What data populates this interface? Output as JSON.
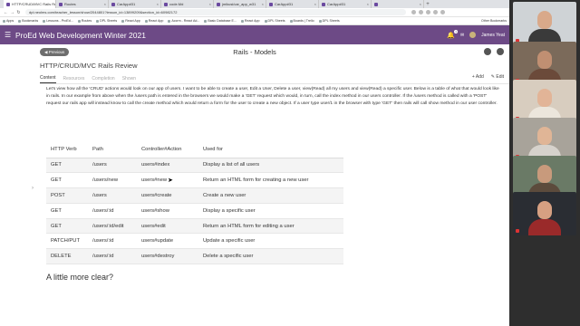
{
  "browser": {
    "tabs": [
      {
        "label": "HTTP/CRUD/MVC Rails Review",
        "active": true
      },
      {
        "label": "Routes",
        "active": false
      },
      {
        "label": "CarApp#31",
        "active": false
      },
      {
        "label": "code.Md",
        "active": false
      },
      {
        "label": "jmikusi/car_app_w31",
        "active": false
      },
      {
        "label": "CarApp#31",
        "active": false
      },
      {
        "label": "CarApp#31",
        "active": false
      },
      {
        "label": "",
        "active": false
      }
    ],
    "new_tab": "+",
    "url": "dpl.neolms.com/teacher_lesson/show/2044801?lesson_id=13899209&section_id=60982172",
    "nav": {
      "back": "←",
      "forward": "→",
      "reload": "↻"
    },
    "bookmarks": [
      "Apps",
      "Bookmarks",
      "Lessons - ProEd...",
      "Routes",
      "DPL Sheets",
      "React App",
      "React App",
      "Accrm - React Ad...",
      "Basic Database E...",
      "React App",
      "DPL Sheets",
      "Boards | Trello",
      "DPL Sheets"
    ],
    "other_bookmarks": "Other Bookmarks"
  },
  "app": {
    "menu_icon": "hamburger-icon",
    "title": "ProEd Web Development Winter 2021",
    "notification_count": "1",
    "user_name": "James Yeat",
    "accent": "#6d4a86"
  },
  "lesson": {
    "previous_label": "Previous",
    "title": "Rails - Models",
    "section_title": "HTTP/CRUD/MVC Rails Review",
    "tabs": [
      "Content",
      "Resources",
      "Completion",
      "Shown"
    ],
    "active_tab": "Content",
    "actions": [
      "+ Add",
      "Edit"
    ],
    "intro": "Let's view how all the 'CRUD' actions would look on our app of users.  I want to be able to create a user, Edit a User, Delete a user, view(Read) all my users and view(Read) a specific user.  Below is a table of what that would look like in rails. In our example from above when the /users path is entered in the browsers we would make a 'GET' request which would, in turn, call the index method in our users controller. If the /users method is called with a 'POST' request our rails app will instead know to call the create method which would return a form for the user to create a new object. If a user type user/1 in the browser with type 'GET' then rails will call show method in our user controller.",
    "table": {
      "headers": [
        "HTTP Verb",
        "Path",
        "Controller#Action",
        "Used for"
      ],
      "rows": [
        [
          "GET",
          "/users",
          "users#index",
          "Display a list of all users"
        ],
        [
          "GET",
          "/users/new",
          "users#new",
          "Return an HTML form for creating a new user"
        ],
        [
          "POST",
          "/users",
          "users#create",
          "Create a new user"
        ],
        [
          "GET",
          "/users/:id",
          "users#show",
          "Display a specific user"
        ],
        [
          "GET",
          "/users/:id/edit",
          "users#edit",
          "Return an HTML form for editing a user"
        ],
        [
          "PATCH/PUT",
          "/users/:id",
          "users#update",
          "Update a specific user"
        ],
        [
          "DELETE",
          "/users/:id",
          "users#destroy",
          "Delete a specific user"
        ]
      ]
    },
    "closing": "A little more clear?"
  },
  "participants": [
    {
      "bg": "#cfd3d6",
      "skin": "#d9a98a",
      "shirt": "#3a3a3a"
    },
    {
      "bg": "#7b6a5a",
      "skin": "#c08f72",
      "shirt": "#6b4a3a"
    },
    {
      "bg": "#d8cdbf",
      "skin": "#e2b497",
      "shirt": "#ece6dc"
    },
    {
      "bg": "#a8a39a",
      "skin": "#e0b596",
      "shirt": "#d6d2cc"
    },
    {
      "bg": "#6a7a66",
      "skin": "#c89a7c",
      "shirt": "#5c4b3c"
    },
    {
      "bg": "#2a2d33",
      "skin": "#d6a082",
      "shirt": "#9a2a2a"
    }
  ]
}
